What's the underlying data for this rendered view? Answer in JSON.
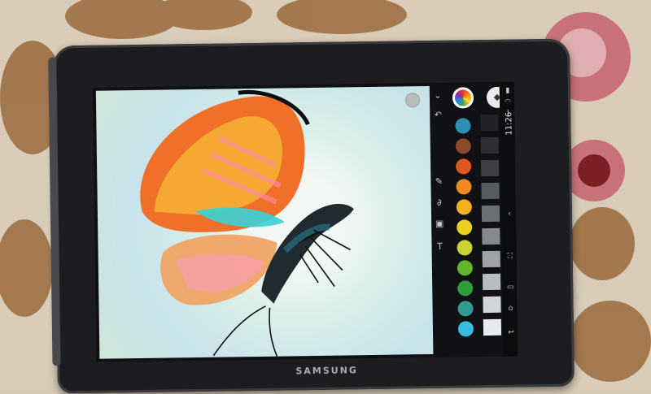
{
  "device": {
    "brand": "SAMSUNG"
  },
  "status_bar": {
    "time": "11:26"
  },
  "colors": {
    "palette": [
      "#2f8fb4",
      "#8a4a2c",
      "#e0571e",
      "#f08a1e",
      "#f2b21f",
      "#e8d21f",
      "#c9d231",
      "#62b42e",
      "#2f9d3a",
      "#2f9b92",
      "#38bde0"
    ],
    "greys": [
      "#222326",
      "#2c2e31",
      "#3c3f43",
      "#575b5f",
      "#6b7075",
      "#858a8f",
      "#9ea3a8",
      "#b8bdc2",
      "#d1d5d9",
      "#e8ebee"
    ]
  },
  "icons": {
    "tools": [
      "chevron-down-icon",
      "undo-icon",
      "brush-icon",
      "smudge-icon",
      "image-icon",
      "text-icon"
    ],
    "system": [
      "battery-icon",
      "wifi-icon",
      "notification-icon",
      "back-icon",
      "home-icon",
      "recent-apps-icon",
      "screenshot-icon"
    ]
  }
}
